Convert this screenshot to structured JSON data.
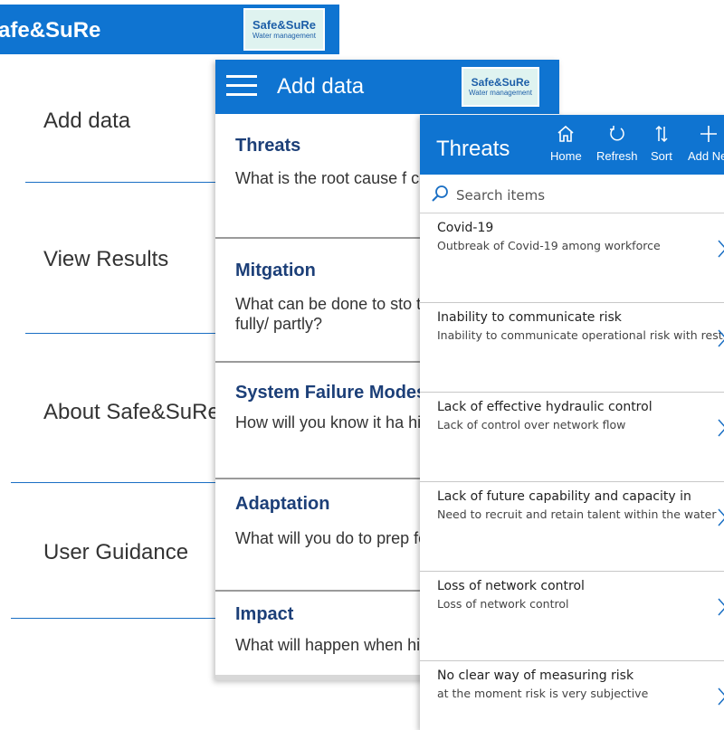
{
  "home": {
    "app_title": "afe&SuRe",
    "logo_line1": "Safe&SuRe",
    "logo_line2": "Water management",
    "menu": [
      "Add data",
      "View Results",
      "About Safe&SuRe",
      "User Guidance"
    ]
  },
  "add_data": {
    "title": "Add data",
    "logo_line1": "Safe&SuRe",
    "logo_line2": "Water management",
    "sections": [
      {
        "title": "Threats",
        "question": "What is the root cause f concern?"
      },
      {
        "title": "Mitgation",
        "question": "What can be done to sto the threat fully/ partly?"
      },
      {
        "title": "System Failure Modes",
        "question": "How will you know it ha hit?"
      },
      {
        "title": "Adaptation",
        "question": "What will you do to prep for impact?"
      },
      {
        "title": "Impact",
        "question": "What will happen when hits you?"
      }
    ]
  },
  "threats": {
    "title": "Threats",
    "toolbar": [
      "Home",
      "Refresh",
      "Sort",
      "Add Ne"
    ],
    "search_placeholder": "Search items",
    "items": [
      {
        "title": "Covid-19",
        "desc": "Outbreak of Covid-19 among workforce"
      },
      {
        "title": "Inability to communicate risk",
        "desc": "Inability to communicate operational risk with rest"
      },
      {
        "title": "Lack of effective hydraulic control",
        "desc": "Lack of control over network flow"
      },
      {
        "title": "Lack of future capability and capacity in",
        "desc": "Need to recruit and retain talent within the water"
      },
      {
        "title": "Loss of network control",
        "desc": "Loss of network control"
      },
      {
        "title": "No clear way of measuring risk",
        "desc": "at the moment risk is very subjective"
      }
    ]
  },
  "colors": {
    "accent": "#0f74d1",
    "heading": "#1c3f78",
    "logo_bg": "#dff3f0"
  }
}
